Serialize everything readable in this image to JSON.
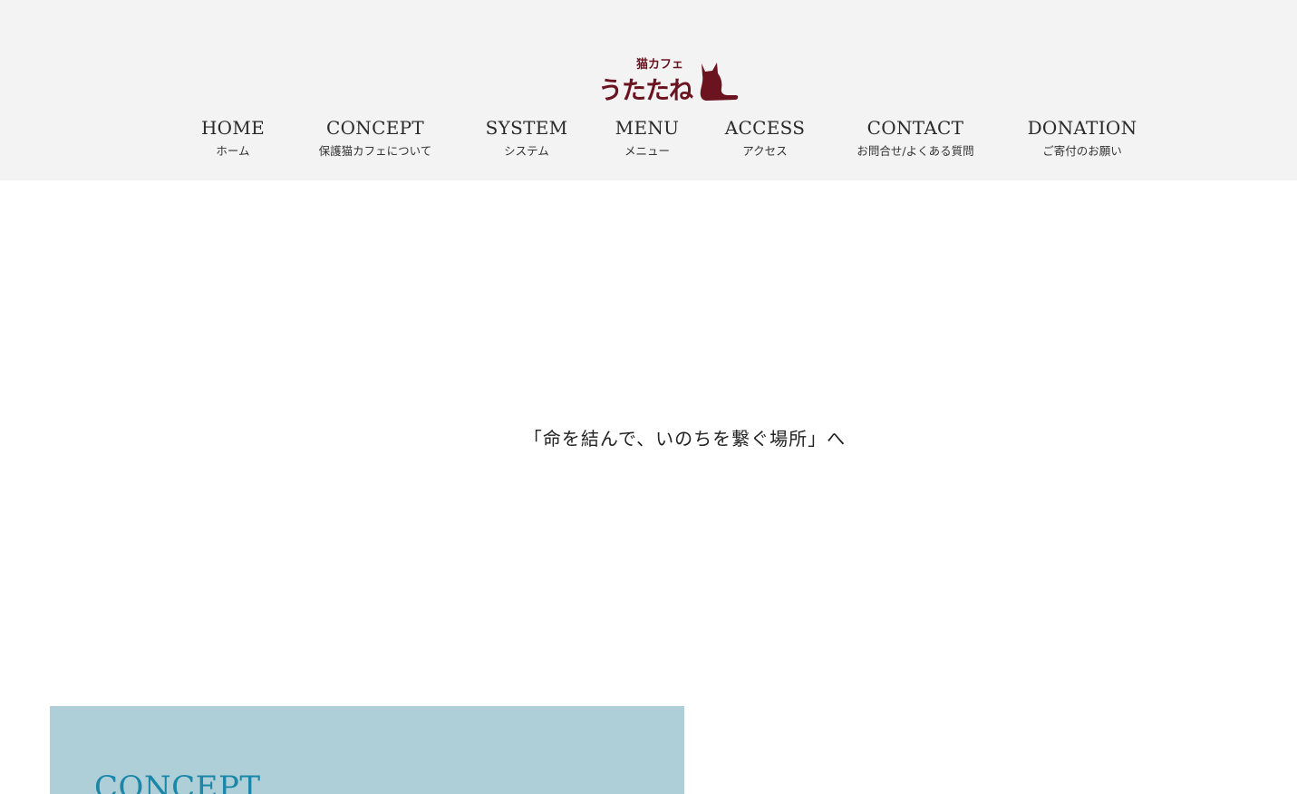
{
  "site": {
    "logo_text_small": "猫カフェ",
    "logo_text_main": "うたたね",
    "logo_color": "#6b1420"
  },
  "nav": {
    "items": [
      {
        "en": "HOME",
        "ja": "ホーム"
      },
      {
        "en": "CONCEPT",
        "ja": "保護猫カフェについて"
      },
      {
        "en": "SYSTEM",
        "ja": "システム"
      },
      {
        "en": "MENU",
        "ja": "メニュー"
      },
      {
        "en": "ACCESS",
        "ja": "アクセス"
      },
      {
        "en": "CONTACT",
        "ja": "お問合せ/よくある質問"
      },
      {
        "en": "DONATION",
        "ja": "ご寄付のお願い"
      }
    ]
  },
  "hero": {
    "tagline": "「命を結んで、いのちを繋ぐ場所」へ"
  },
  "concept": {
    "heading": "CONCEPT",
    "box_color": "#afcfd8",
    "heading_color": "#1a87a8"
  },
  "colors": {
    "header_bg": "#f3f3f3",
    "page_bg": "#ffffff",
    "text": "#222222"
  }
}
